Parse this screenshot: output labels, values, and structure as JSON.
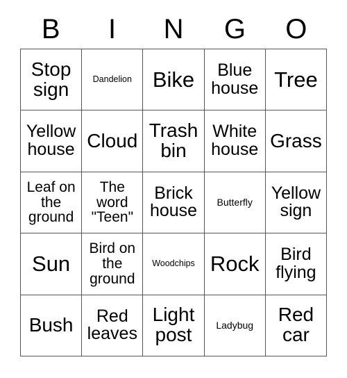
{
  "card": {
    "title_letters": [
      "B",
      "I",
      "N",
      "G",
      "O"
    ],
    "columns": 5,
    "rows": 5,
    "border_color": "#555555",
    "text_color": "#000000",
    "background_color": "#ffffff",
    "cells": [
      [
        {
          "text": "Stop sign",
          "size": "lg"
        },
        {
          "text": "Dandelion",
          "size": "tiny"
        },
        {
          "text": "Bike",
          "size": "xl"
        },
        {
          "text": "Blue house",
          "size": "md"
        },
        {
          "text": "Tree",
          "size": "xl"
        }
      ],
      [
        {
          "text": "Yellow house",
          "size": "md"
        },
        {
          "text": "Cloud",
          "size": "lg"
        },
        {
          "text": "Trash bin",
          "size": "lg"
        },
        {
          "text": "White house",
          "size": "md"
        },
        {
          "text": "Grass",
          "size": "lg"
        }
      ],
      [
        {
          "text": "Leaf on the ground",
          "size": "sm"
        },
        {
          "text": "The word \"Teen\"",
          "size": "sm"
        },
        {
          "text": "Brick house",
          "size": "md"
        },
        {
          "text": "Butterfly",
          "size": "xxs"
        },
        {
          "text": "Yellow sign",
          "size": "md"
        }
      ],
      [
        {
          "text": "Sun",
          "size": "xl"
        },
        {
          "text": "Bird on the ground",
          "size": "sm"
        },
        {
          "text": "Woodchips",
          "size": "tiny"
        },
        {
          "text": "Rock",
          "size": "xl"
        },
        {
          "text": "Bird flying",
          "size": "md"
        }
      ],
      [
        {
          "text": "Bush",
          "size": "lg"
        },
        {
          "text": "Red leaves",
          "size": "md"
        },
        {
          "text": "Light post",
          "size": "lg"
        },
        {
          "text": "Ladybug",
          "size": "xxs"
        },
        {
          "text": "Red car",
          "size": "lg"
        }
      ]
    ]
  }
}
